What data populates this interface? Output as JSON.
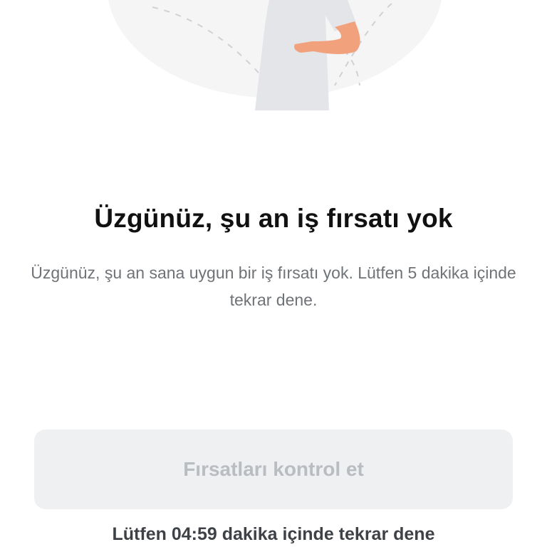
{
  "empty_state": {
    "illustration": "person-with-hand-on-waist-illustration",
    "title": "Üzgünüz, şu an iş fırsatı yok",
    "message": "Üzgünüz, şu an sana uygun bir iş fırsatı yok. Lütfen 5 dakika içinde tekrar dene."
  },
  "action": {
    "button_label": "Fırsatları kontrol et",
    "disabled": true,
    "countdown_text": "Lütfen 04:59 dakika içinde tekrar dene"
  },
  "colors": {
    "background": "#ffffff",
    "title": "#111111",
    "message": "#6f7377",
    "button_bg_disabled": "#eff0f2",
    "button_text_disabled": "#b9bcc1",
    "countdown": "#3e4247"
  }
}
